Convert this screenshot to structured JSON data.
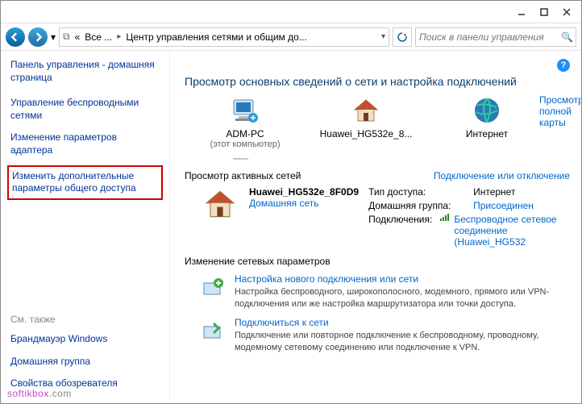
{
  "titlebar": {
    "min": "–",
    "max": "□",
    "close": "✕"
  },
  "nav": {
    "breadcrumb_prefix": "«",
    "seg1": "Все ...",
    "seg2": "Центр управления сетями и общим до...",
    "search_placeholder": "Поиск в панели управления"
  },
  "sidebar": {
    "heading": "Панель управления - домашняя страница",
    "items": [
      "Управление беспроводными сетями",
      "Изменение параметров адаптера",
      "Изменить дополнительные параметры общего доступа"
    ],
    "also_label": "См. также",
    "also": [
      "Брандмауэр Windows",
      "Домашняя группа",
      "Свойства обозревателя"
    ]
  },
  "main": {
    "title": "Просмотр основных сведений о сети и настройка подключений",
    "map_link": "Просмотр полной карты",
    "nodes": {
      "pc": {
        "label": "ADM-PC",
        "sub": "(этот компьютер)"
      },
      "router": {
        "label": "Huawei_HG532e_8...",
        "sub": ""
      },
      "internet": {
        "label": "Интернет",
        "sub": ""
      }
    },
    "active_title": "Просмотр активных сетей",
    "active_link": "Подключение или отключение",
    "network": {
      "name": "Huawei_HG532e_8F0D9",
      "type": "Домашняя сеть",
      "props": {
        "access_k": "Тип доступа:",
        "access_v": "Интернет",
        "home_k": "Домашняя группа:",
        "home_v": "Присоединен",
        "conn_k": "Подключения:",
        "conn_v": "Беспроводное сетевое соединение (Huawei_HG532"
      }
    },
    "settings_title": "Изменение сетевых параметров",
    "s1": {
      "title": "Настройка нового подключения или сети",
      "desc": "Настройка беспроводного, широкополосного, модемного, прямого или VPN-подключения или же настройка маршрутизатора или точки доступа."
    },
    "s2": {
      "title": "Подключиться к сети",
      "desc": "Подключение или повторное подключение к беспроводному, проводному, модемному сетевому соединению или подключение к VPN."
    }
  },
  "watermark": {
    "a": "softikbox",
    "b": ".com"
  }
}
